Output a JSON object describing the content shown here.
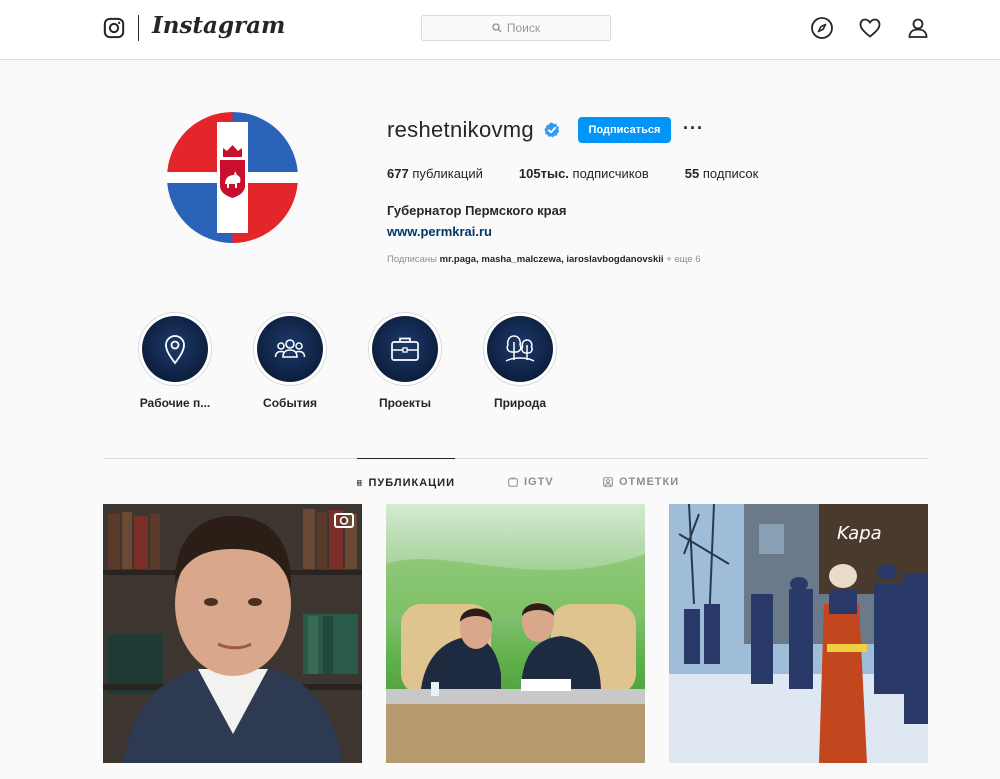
{
  "header": {
    "logo_text": "Instagram",
    "search_placeholder": "Поиск"
  },
  "profile": {
    "username": "reshetnikovmg",
    "follow_label": "Подписаться",
    "more_label": "···",
    "stats": [
      {
        "value": "677",
        "label": "публикаций"
      },
      {
        "value": "105тыс.",
        "label": "подписчиков"
      },
      {
        "value": "55",
        "label": "подписок"
      }
    ],
    "full_name": "Губернатор Пермского края",
    "website": "www.permkrai.ru",
    "followed_by_prefix": "Подписаны",
    "followed_by_users": "mr.paga, masha_malczewa, iaroslavbogdanovskii",
    "followed_by_more": "+ еще 6"
  },
  "highlights": [
    {
      "label": "Рабочие п...",
      "icon": "location-pin-icon"
    },
    {
      "label": "События",
      "icon": "people-group-icon"
    },
    {
      "label": "Проекты",
      "icon": "briefcase-icon"
    },
    {
      "label": "Природа",
      "icon": "trees-icon"
    }
  ],
  "tabs": [
    {
      "label": "ПУБЛИКАЦИИ",
      "icon": "grid-icon",
      "active": true
    },
    {
      "label": "IGTV",
      "icon": "igtv-icon",
      "active": false
    },
    {
      "label": "ОТМЕТКИ",
      "icon": "tagged-icon",
      "active": false
    }
  ],
  "colors": {
    "accent": "#0095f6",
    "verified": "#3897f0",
    "flag_red": "#e4262b",
    "flag_blue": "#2b63b8",
    "highlight_bg": "#0d1f3f"
  }
}
